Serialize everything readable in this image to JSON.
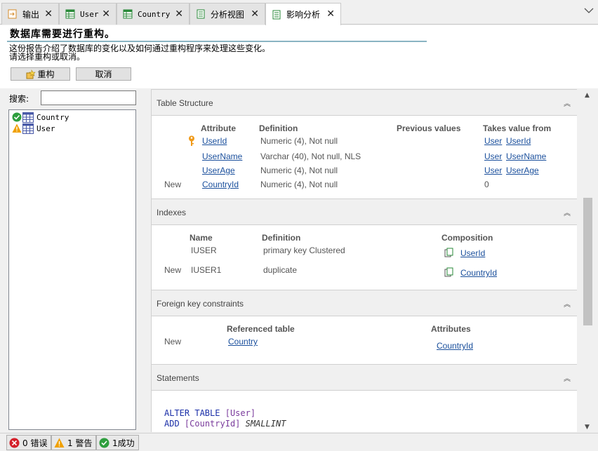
{
  "tabs": [
    {
      "label": "输出",
      "icon": "output-icon",
      "active": false
    },
    {
      "label": "User",
      "icon": "table-icon",
      "active": false
    },
    {
      "label": "Country",
      "icon": "table-icon",
      "active": false
    },
    {
      "label": "分析视图",
      "icon": "document-icon",
      "active": false
    },
    {
      "label": "影响分析",
      "icon": "document-icon",
      "active": true
    }
  ],
  "header": {
    "title": "数据库需要进行重构。",
    "line1": "这份报告介绍了数据库的变化以及如何通过重构程序来处理这些变化。",
    "line2": "请选择重构或取消。",
    "reorg_label": "重构",
    "cancel_label": "取消"
  },
  "search": {
    "label": "搜索:",
    "value": ""
  },
  "tree": [
    {
      "label": "Country",
      "status": "success-icon"
    },
    {
      "label": "User",
      "status": "warning-icon"
    }
  ],
  "table_structure": {
    "title": "Table Structure",
    "headers": {
      "attribute": "Attribute",
      "definition": "Definition",
      "previous": "Previous values",
      "takes": "Takes value from"
    },
    "rows": [
      {
        "mark": "",
        "key": true,
        "attribute": "UserId",
        "definition": "Numeric (4), Not null",
        "previous": "",
        "takes_obj": "User",
        "takes_attr": "UserId"
      },
      {
        "mark": "",
        "key": false,
        "attribute": "UserName",
        "definition": "Varchar (40), Not null, NLS",
        "previous": "",
        "takes_obj": "User",
        "takes_attr": "UserName"
      },
      {
        "mark": "",
        "key": false,
        "attribute": "UserAge",
        "definition": "Numeric (4), Not null",
        "previous": "",
        "takes_obj": "User",
        "takes_attr": "UserAge"
      },
      {
        "mark": "New",
        "key": false,
        "attribute": "CountryId",
        "definition": "Numeric (4), Not null",
        "previous": "",
        "takes_value": "0"
      }
    ]
  },
  "indexes": {
    "title": "Indexes",
    "headers": {
      "name": "Name",
      "definition": "Definition",
      "composition": "Composition"
    },
    "rows": [
      {
        "mark": "",
        "name": "IUSER",
        "definition": "primary key Clustered",
        "composition": "UserId"
      },
      {
        "mark": "New",
        "name": "IUSER1",
        "definition": "duplicate",
        "composition": "CountryId"
      }
    ]
  },
  "foreign_keys": {
    "title": "Foreign key constraints",
    "headers": {
      "referenced": "Referenced table",
      "attributes": "Attributes"
    },
    "rows": [
      {
        "mark": "New",
        "referenced": "Country",
        "attributes": "CountryId"
      }
    ]
  },
  "statements": {
    "title": "Statements",
    "line1_kw": "ALTER TABLE",
    "line1_id": "[User]",
    "line2_kw": "ADD",
    "line2_id": "[CountryId]",
    "line2_type": "SMALLINT"
  },
  "status": {
    "errors": "0 错误",
    "warnings": "1 警告",
    "success": "1成功"
  },
  "colors": {
    "link": "#1a4f9c",
    "keyword": "#1b2fa8",
    "identifier": "#7a3b9c",
    "success": "#2e9e3e",
    "warning": "#f0a000",
    "error": "#d4202a"
  }
}
